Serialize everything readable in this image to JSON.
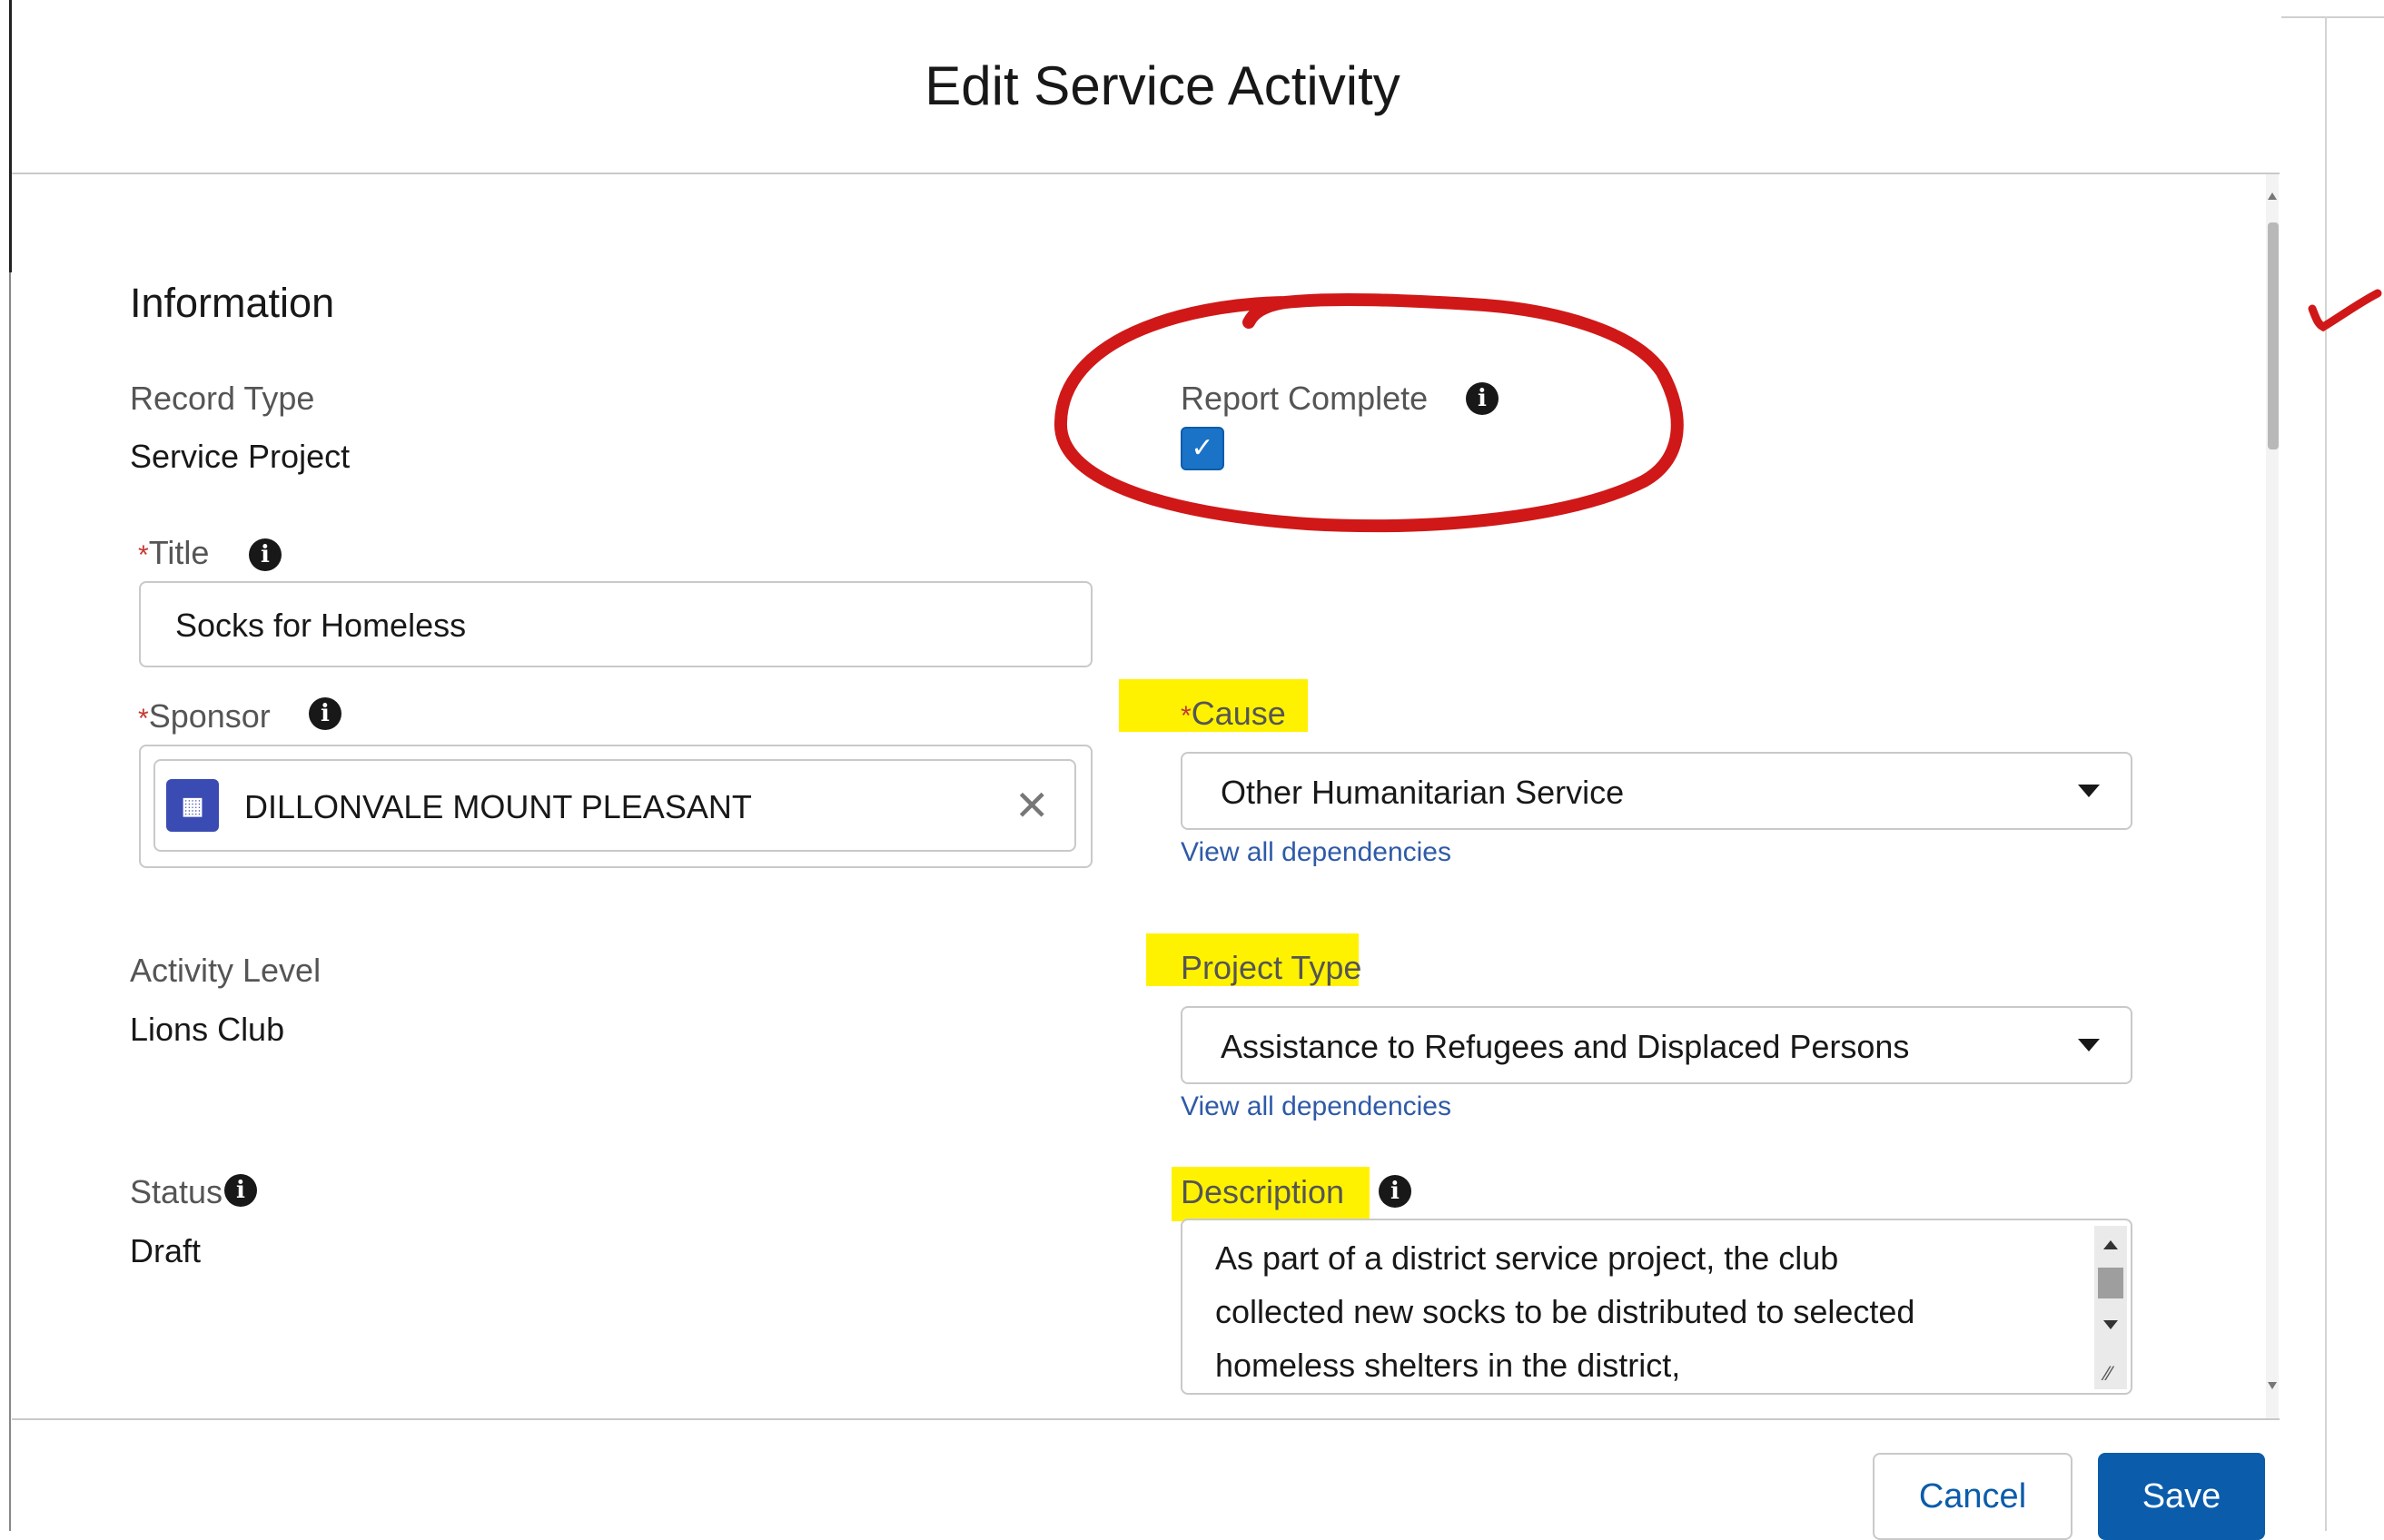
{
  "modal": {
    "title": "Edit Service Activity",
    "section_title": "Information"
  },
  "fields": {
    "record_type": {
      "label": "Record Type",
      "value": "Service Project"
    },
    "report_complete": {
      "label": "Report Complete",
      "checked": true
    },
    "title": {
      "label": "Title",
      "required_mark": "*",
      "value": "Socks for Homeless"
    },
    "sponsor": {
      "label": "Sponsor",
      "required_mark": "*",
      "value": "DILLONVALE MOUNT PLEASANT"
    },
    "cause": {
      "label": "Cause",
      "required_mark": "*",
      "value": "Other Humanitarian Service",
      "link": "View all dependencies"
    },
    "activity_level": {
      "label": "Activity Level",
      "value": "Lions Club"
    },
    "project_type": {
      "label": "Project Type",
      "value": "Assistance to Refugees and Displaced Persons",
      "link": "View all dependencies"
    },
    "status": {
      "label": "Status",
      "value": "Draft"
    },
    "description": {
      "label": "Description",
      "lines": [
        "As part of a district service project, the club",
        "collected new socks to be distributed to selected",
        "homeless shelters in the district,"
      ]
    }
  },
  "footer": {
    "cancel_label": "Cancel",
    "save_label": "Save"
  },
  "icons": {
    "info": "info-icon",
    "checkbox": "check-icon",
    "account": "account-icon",
    "clear": "close-icon",
    "dropdown": "chevron-down-icon"
  },
  "colors": {
    "brand_blue": "#0b5cab",
    "annotation_red": "#d01818",
    "highlight_yellow": "#fff200"
  }
}
